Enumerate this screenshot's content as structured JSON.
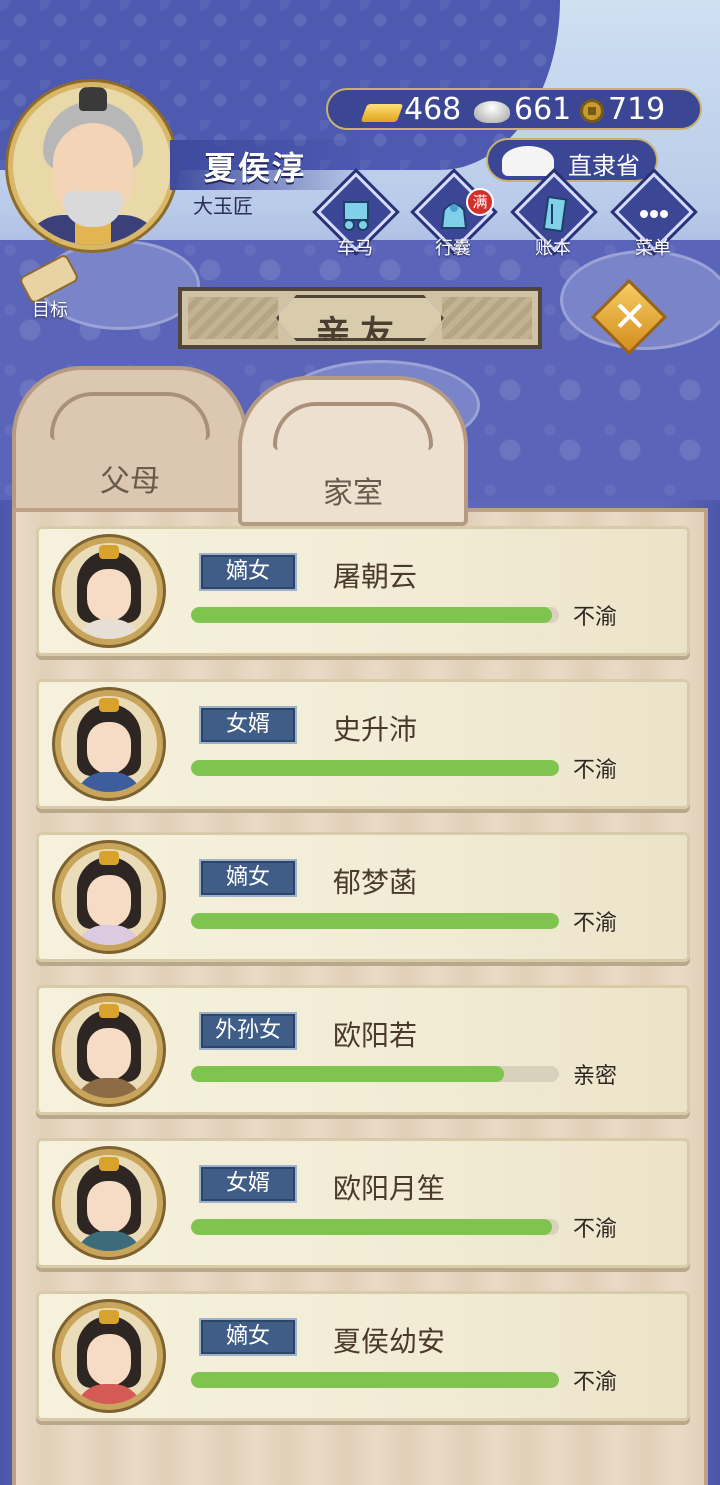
{
  "player": {
    "name": "夏侯淳",
    "title": "大玉匠"
  },
  "currency": {
    "gold": "468",
    "silver": "661",
    "coins": "719"
  },
  "region": {
    "label": "直隶省"
  },
  "menu": {
    "items": [
      {
        "label": "车马",
        "icon": "carriage-icon"
      },
      {
        "label": "行囊",
        "icon": "bag-icon",
        "badge": "满"
      },
      {
        "label": "账本",
        "icon": "ledger-icon"
      },
      {
        "label": "菜单",
        "icon": "more-icon"
      }
    ]
  },
  "goal": {
    "label": "目标"
  },
  "panel": {
    "title": "亲友"
  },
  "tabs": [
    {
      "label": "父母",
      "active": false
    },
    {
      "label": "家室",
      "active": true
    }
  ],
  "members": [
    {
      "relation": "嫡女",
      "name": "屠朝云",
      "affinity": 0.98,
      "mood": "不渝",
      "outfit": "#e7dfd4"
    },
    {
      "relation": "女婿",
      "name": "史升沛",
      "affinity": 1.0,
      "mood": "不渝",
      "outfit": "#3d5d9c"
    },
    {
      "relation": "嫡女",
      "name": "郁梦菡",
      "affinity": 1.0,
      "mood": "不渝",
      "outfit": "#dccbe0"
    },
    {
      "relation": "外孙女",
      "name": "欧阳若",
      "affinity": 0.85,
      "mood": "亲密",
      "outfit": "#8d6b45"
    },
    {
      "relation": "女婿",
      "name": "欧阳月笙",
      "affinity": 0.98,
      "mood": "不渝",
      "outfit": "#3e6b7a"
    },
    {
      "relation": "嫡女",
      "name": "夏侯幼安",
      "affinity": 1.0,
      "mood": "不渝",
      "outfit": "#d45a55"
    }
  ],
  "colors": {
    "accent_blue": "#3b4694",
    "badge_blue": "#3f5d86",
    "bar_green": "#7ec44e",
    "close_gold": "#f0b03a"
  }
}
